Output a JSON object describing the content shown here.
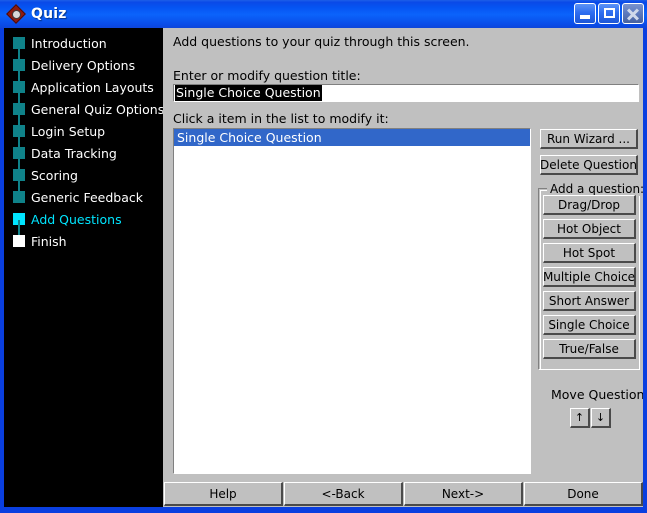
{
  "window": {
    "title": "Quiz",
    "icon": "quiz-diamond-icon",
    "controls": {
      "minimize": "minimize-icon",
      "maximize": "maximize-icon",
      "close": "close-icon"
    }
  },
  "sidebar": {
    "items": [
      {
        "label": "Introduction",
        "state": "done"
      },
      {
        "label": "Delivery Options",
        "state": "done"
      },
      {
        "label": "Application Layouts",
        "state": "done"
      },
      {
        "label": "General Quiz Options",
        "state": "done"
      },
      {
        "label": "Login Setup",
        "state": "done"
      },
      {
        "label": "Data Tracking",
        "state": "done"
      },
      {
        "label": "Scoring",
        "state": "done"
      },
      {
        "label": "Generic Feedback",
        "state": "done"
      },
      {
        "label": "Add Questions",
        "state": "current"
      },
      {
        "label": "Finish",
        "state": "last"
      }
    ],
    "colors": {
      "done_square": "#0f8289",
      "current_square": "#00e5ff",
      "last_square": "#ffffff",
      "background": "#000000",
      "current_text": "#00e5ff"
    }
  },
  "main": {
    "intro_text": "Add questions to your quiz through this screen.",
    "title_label": "Enter or modify question title:",
    "question_title_value": "Single Choice Question",
    "question_title_placeholder": "",
    "list_label": "Click a item in the list to modify it:",
    "list_items": [
      {
        "label": "Single Choice Question",
        "selected": true
      }
    ],
    "selection_color": "#3167c9"
  },
  "right_panel": {
    "run_wizard": "Run Wizard ...",
    "delete_question": "Delete Question",
    "group_title": "Add a question:",
    "question_types": [
      "Drag/Drop",
      "Hot Object",
      "Hot Spot",
      "Multiple Choice",
      "Short Answer",
      "Single Choice",
      "True/False"
    ],
    "move_label": "Move Question:",
    "move_up": "↑",
    "move_down": "↓"
  },
  "bottom_bar": {
    "help": "Help",
    "back": "<-Back",
    "next": "Next->",
    "done": "Done"
  }
}
